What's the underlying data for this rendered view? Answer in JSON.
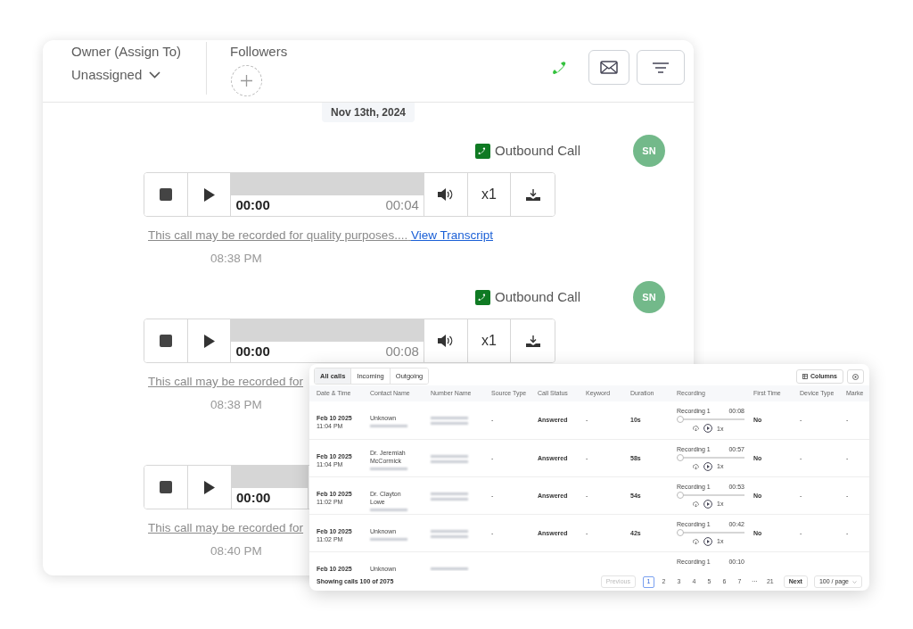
{
  "back_panel": {
    "owner_label": "Owner (Assign To)",
    "owner_value": "Unassigned",
    "followers_label": "Followers",
    "date_chip": "Nov 13th, 2024",
    "entries": [
      {
        "label": "Outbound Call",
        "avatar": "SN",
        "elapsed": "00:00",
        "duration": "00:04",
        "speed": "x1",
        "disclaimer": "This call may be recorded for quality purposes....",
        "link": "View Transcript",
        "time": "08:38 PM"
      },
      {
        "label": "Outbound Call",
        "avatar": "SN",
        "elapsed": "00:00",
        "duration": "00:08",
        "speed": "x1",
        "disclaimer": "This call may be recorded for",
        "time": "08:38 PM"
      },
      {
        "elapsed": "00:00",
        "disclaimer": "This call may be recorded for",
        "time": "08:40 PM"
      }
    ]
  },
  "calls_table": {
    "tabs": [
      {
        "label": "All calls",
        "selected": true
      },
      {
        "label": "Incoming",
        "selected": false
      },
      {
        "label": "Outgoing",
        "selected": false
      }
    ],
    "columns_button": "Columns",
    "columns": [
      "Date & Time",
      "Contact Name",
      "Number Name",
      "Source Type",
      "Call Status",
      "Keyword",
      "Duration",
      "Recording",
      "First Time",
      "Device Type",
      "Marke"
    ],
    "rows": [
      {
        "date": "Feb 10 2025",
        "time": "11:04 PM",
        "contact": "Unknown",
        "source": "-",
        "status": "Answered",
        "keyword": "-",
        "duration": "10s",
        "recording": {
          "label": "Recording 1",
          "time": "00:08",
          "level": 0,
          "speed": "1x"
        },
        "first_time": "No",
        "device": "-",
        "market": "-"
      },
      {
        "date": "Feb 10 2025",
        "time": "11:04 PM",
        "contact": "Dr. Jeremiah McCormick",
        "source": "-",
        "status": "Answered",
        "keyword": "-",
        "duration": "58s",
        "recording": {
          "label": "Recording 1",
          "time": "00:57",
          "level": 0,
          "speed": "1x"
        },
        "first_time": "No",
        "device": "-",
        "market": "-"
      },
      {
        "date": "Feb 10 2025",
        "time": "11:02 PM",
        "contact": "Dr. Clayton Lowe",
        "source": "-",
        "status": "Answered",
        "keyword": "-",
        "duration": "54s",
        "recording": {
          "label": "Recording 1",
          "time": "00:53",
          "level": 0,
          "speed": "1x"
        },
        "first_time": "No",
        "device": "-",
        "market": "-"
      },
      {
        "date": "Feb 10 2025",
        "time": "11:02 PM",
        "contact": "Unknown",
        "source": "-",
        "status": "Answered",
        "keyword": "-",
        "duration": "42s",
        "recording": {
          "label": "Recording 1",
          "time": "00:42",
          "level": 0,
          "speed": "1x"
        },
        "first_time": "No",
        "device": "-",
        "market": "-"
      },
      {
        "date": "Feb 10 2025",
        "contact": "Unknown",
        "recording": {
          "label": "Recording 1",
          "time": "00:10"
        }
      }
    ],
    "footer": "Showing calls 100 of 2075",
    "pagination": {
      "previous": {
        "label": "Previous",
        "disabled": true
      },
      "pages": [
        {
          "label": "1",
          "selected": true
        },
        {
          "label": "2",
          "selected": false
        },
        {
          "label": "3",
          "selected": false
        },
        {
          "label": "4",
          "selected": false
        },
        {
          "label": "5",
          "selected": false
        },
        {
          "label": "6",
          "selected": false
        },
        {
          "label": "7",
          "selected": false
        },
        {
          "label": "···",
          "selected": false
        },
        {
          "label": "21",
          "selected": false
        }
      ],
      "next": "Next",
      "page_size": "100 / page"
    }
  }
}
